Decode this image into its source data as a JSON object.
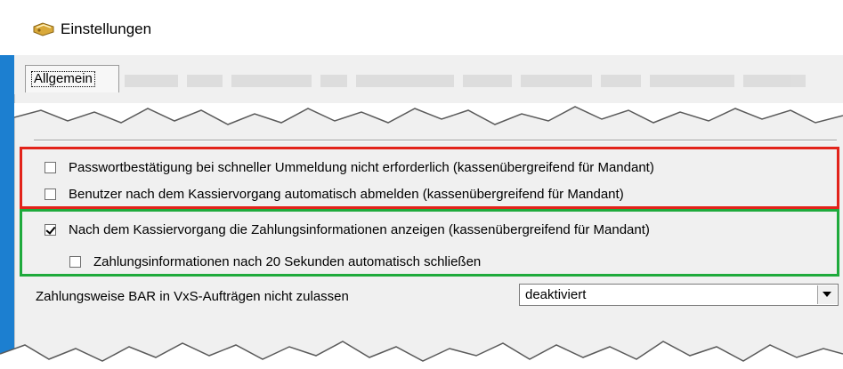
{
  "window": {
    "title": "Einstellungen"
  },
  "tabs": {
    "active_label": "Allgemein"
  },
  "options": {
    "password_confirm": {
      "label": "Passwortbestätigung bei schneller Ummeldung nicht erforderlich (kassenübergreifend für Mandant)",
      "checked": false
    },
    "auto_logout": {
      "label": "Benutzer nach dem Kassiervorgang automatisch abmelden (kassenübergreifend für Mandant)",
      "checked": false
    },
    "show_payment_info": {
      "label": "Nach dem Kassiervorgang die Zahlungsinformationen anzeigen (kassenübergreifend für Mandant)",
      "checked": true
    },
    "auto_close_payment_info": {
      "label": "Zahlungsinformationen nach 20 Sekunden automatisch schließen",
      "checked": false
    }
  },
  "payment_method": {
    "label": "Zahlungsweise BAR in VxS-Aufträgen nicht zulassen",
    "selected": "deaktiviert"
  },
  "colors": {
    "highlight_red": "#e2231a",
    "highlight_green": "#1faa3c",
    "window_border": "#1c7fd0"
  },
  "icons": {
    "title": "settings-tag-icon",
    "dropdown": "chevron-down-icon"
  }
}
